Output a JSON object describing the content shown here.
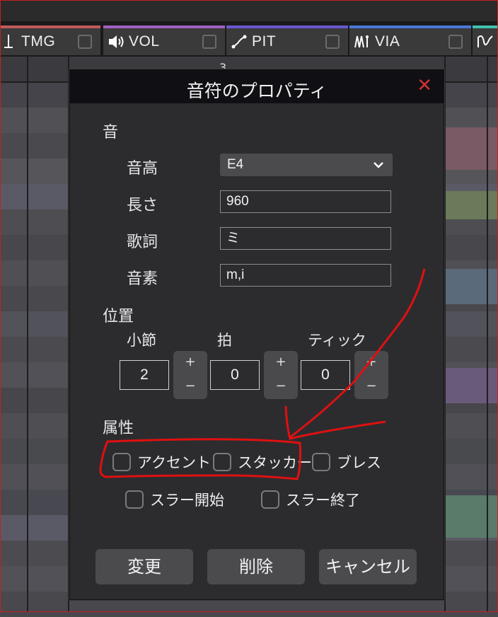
{
  "tabs": [
    {
      "label": "TMG",
      "icon": "tempo-icon"
    },
    {
      "label": "VOL",
      "icon": "speaker-icon"
    },
    {
      "label": "PIT",
      "icon": "pitch-curve-icon"
    },
    {
      "label": "VIA",
      "icon": "vibrato-icon"
    },
    {
      "label": "",
      "icon": "wave-icon"
    }
  ],
  "ruler": {
    "measure": "3"
  },
  "dialog": {
    "title": "音符のプロパティ",
    "sound_section": "音",
    "pitch_label": "音高",
    "pitch_value": "E4",
    "length_label": "長さ",
    "length_value": "960",
    "lyric_label": "歌詞",
    "lyric_value": "ミ",
    "phoneme_label": "音素",
    "phoneme_value": "m,i",
    "position_section": "位置",
    "measure_label": "小節",
    "measure_value": "2",
    "beat_label": "拍",
    "beat_value": "0",
    "tick_label": "ティック",
    "tick_value": "0",
    "stepper_plus": "+",
    "stepper_minus": "−",
    "attr_section": "属性",
    "accent": "アクセント",
    "staccato": "スタッカート",
    "breath": "ブレス",
    "slur_start": "スラー開始",
    "slur_end": "スラー終了",
    "apply": "変更",
    "delete": "削除",
    "cancel": "キャンセル"
  },
  "colors": {
    "annotation": "#e01010",
    "close": "#c33333"
  }
}
